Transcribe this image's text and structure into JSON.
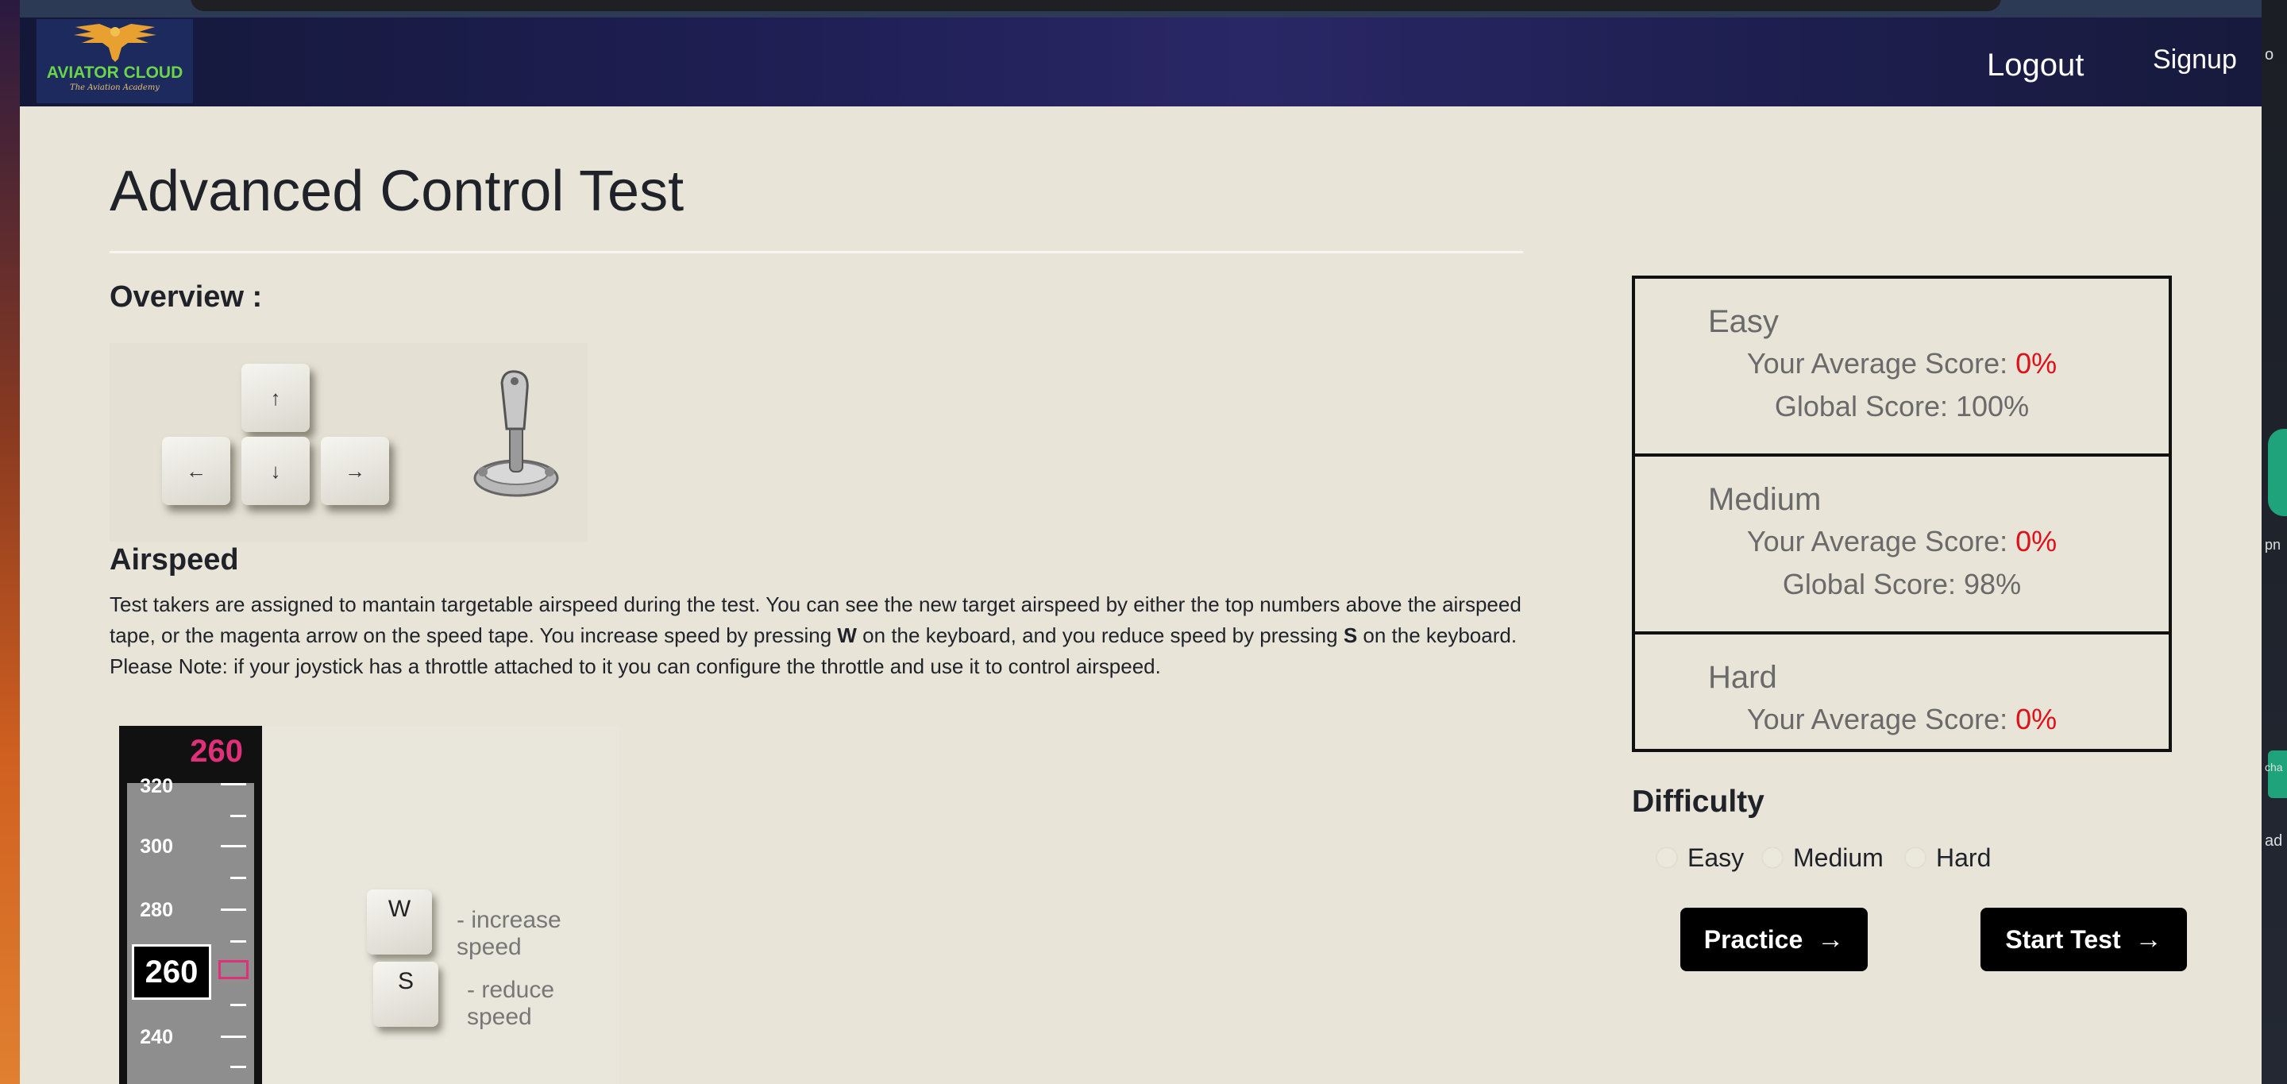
{
  "navbar": {
    "logo_brand": "AVIATOR CLOUD",
    "logo_tagline": "The Aviation Academy",
    "logout_label": "Logout",
    "signup_label": "Signup"
  },
  "page": {
    "title": "Advanced Control Test",
    "overview_heading": "Overview :",
    "airspeed_heading": "Airspeed",
    "airspeed_text_1": "Test takers are assigned to mantain targetable airspeed during the test. You can see the new target airspeed by either the top numbers above the airspeed tape, or the magenta arrow on the speed tape. You increase speed by pressing ",
    "airspeed_key_w": "W",
    "airspeed_text_2": " on the keyboard, and you reduce speed by pressing ",
    "airspeed_key_s": "S",
    "airspeed_text_3": " on the keyboard. Please Note: if your joystick has a throttle attached to it you can configure the throttle and use it to control airspeed."
  },
  "keys_image": {
    "up": "↑",
    "left": "←",
    "down": "↓",
    "right": "→"
  },
  "tape_image": {
    "target_speed": "260",
    "current_speed": "260",
    "tick_labels": [
      "320",
      "300",
      "280",
      "240"
    ],
    "w_key": "W",
    "s_key": "S",
    "increase_label": "- increase speed",
    "reduce_label": "- reduce speed"
  },
  "scores": {
    "average_prefix": "Your Average Score: ",
    "global_prefix": "Global Score: ",
    "cards": [
      {
        "name": "Easy",
        "average": "0%",
        "global": "100%"
      },
      {
        "name": "Medium",
        "average": "0%",
        "global": "98%"
      },
      {
        "name": "Hard",
        "average": "0%",
        "global": ""
      }
    ]
  },
  "difficulty": {
    "heading": "Difficulty",
    "options": [
      "Easy",
      "Medium",
      "Hard"
    ]
  },
  "buttons": {
    "practice": "Practice",
    "start_test": "Start Test",
    "arrow": "→"
  },
  "desktop": {
    "right_fragments": [
      "o",
      "pn",
      "cha",
      "ad"
    ]
  },
  "colors": {
    "score_value": "#e0101a",
    "tape_target": "#e0307a",
    "background": "#e8e4d8"
  }
}
